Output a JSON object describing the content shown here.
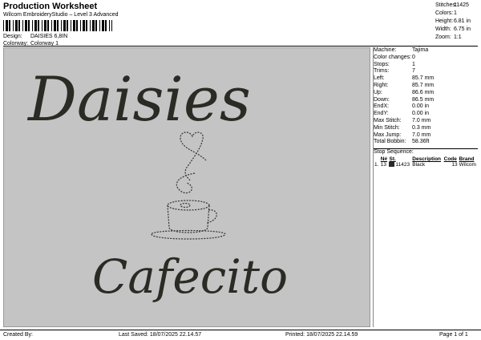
{
  "header": {
    "title": "Production Worksheet",
    "subtitle": "Wilcom EmbroideryStudio – Level 3 Advanced",
    "design_label": "Design:",
    "design_value": "DAISIES 6,8IN",
    "colorway_label": "Colorway:",
    "colorway_value": "Colorway 1"
  },
  "stats": [
    {
      "label": "Stitches:",
      "value": "11425"
    },
    {
      "label": "Colors:",
      "value": "1"
    },
    {
      "label": "Height:",
      "value": "6.81 in"
    },
    {
      "label": "Width:",
      "value": "6.75 in"
    },
    {
      "label": "Zoom:",
      "value": "1:1"
    }
  ],
  "design": {
    "line1": "Daisies",
    "line2": "Cafecito",
    "thread_color": "#2b2b25",
    "canvas_color": "#c4c4c4"
  },
  "info": [
    {
      "label": "Machine:",
      "value": "Tajima"
    },
    {
      "label": "Color changes:",
      "value": "0"
    },
    {
      "label": "Stops:",
      "value": "1"
    },
    {
      "label": "Trims:",
      "value": "7"
    },
    {
      "label": "Left:",
      "value": "85.7 mm"
    },
    {
      "label": "Right:",
      "value": "85.7 mm"
    },
    {
      "label": "Up:",
      "value": "86.6 mm"
    },
    {
      "label": "Down:",
      "value": "86.5 mm"
    },
    {
      "label": "EndX:",
      "value": "0.00 in"
    },
    {
      "label": "EndY:",
      "value": "0.00 in"
    },
    {
      "label": "Max Stitch:",
      "value": "7.0 mm"
    },
    {
      "label": "Min Stitch:",
      "value": "0.3 mm"
    },
    {
      "label": "Max Jump:",
      "value": "7.0 mm"
    },
    {
      "label": "Total Bobbin:",
      "value": "58.36ft"
    }
  ],
  "stop_sequence": {
    "title": "Stop Sequence:",
    "headers": [
      "",
      "N#",
      "St.",
      "Description",
      "Code",
      "Brand"
    ],
    "rows": [
      {
        "index": "1.",
        "n": "13",
        "st": "11423",
        "description": "Black",
        "code": "13",
        "brand": "Wilcom"
      }
    ]
  },
  "footer": {
    "created_by": "Created By:",
    "last_saved": "Last Saved: 18/07/2025 22.14.57",
    "printed": "Printed: 18/07/2025 22.14.59",
    "page": "Page 1 of 1"
  }
}
